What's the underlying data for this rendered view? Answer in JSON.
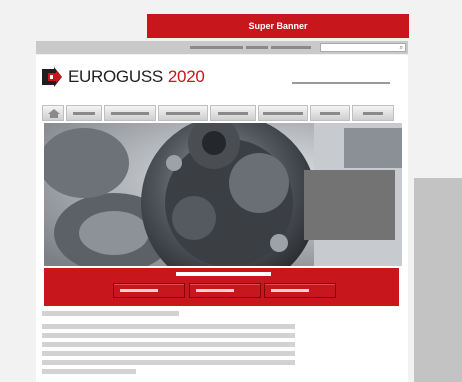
{
  "super_banner": {
    "label": "Super Banner"
  },
  "search": {
    "icon": "search-icon",
    "glyph": "⌕",
    "placeholder": ""
  },
  "header": {
    "logo_name": "EUROGUSS",
    "logo_year": "2020"
  },
  "nav": {
    "home_icon": "home-icon",
    "item_count": 8
  },
  "colors": {
    "brand_red": "#c8161d",
    "placeholder_gray": "#8a8a8a",
    "overlay_gray": "#737373"
  }
}
